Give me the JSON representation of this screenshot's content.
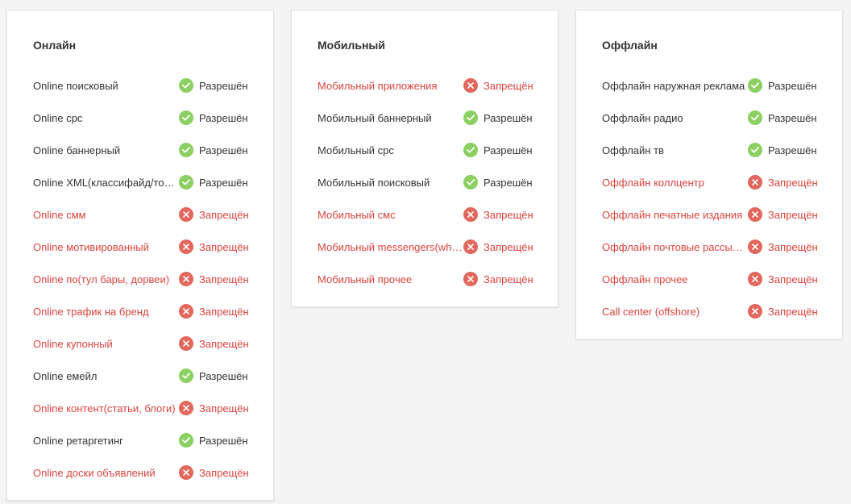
{
  "colors": {
    "allowed": "#8ccf62",
    "denied": "#e2675d",
    "denied_text": "#d9433d"
  },
  "status_labels": {
    "allowed": "Разрешён",
    "denied": "Запрещён"
  },
  "cards": [
    {
      "title": "Онлайн",
      "rows": [
        {
          "label": "Online поисковый",
          "status": "allowed"
        },
        {
          "label": "Online cpc",
          "status": "allowed"
        },
        {
          "label": "Online баннерный",
          "status": "allowed"
        },
        {
          "label": "Online XML(классифайд/товарный)",
          "status": "allowed"
        },
        {
          "label": "Online смм",
          "status": "denied"
        },
        {
          "label": "Online мотивированный",
          "status": "denied"
        },
        {
          "label": "Online по(тул бары, дорвеи)",
          "status": "denied"
        },
        {
          "label": "Online трафик на бренд",
          "status": "denied"
        },
        {
          "label": "Online купонный",
          "status": "denied"
        },
        {
          "label": "Online емейл",
          "status": "allowed"
        },
        {
          "label": "Online контент(статьи, блоги)",
          "status": "denied"
        },
        {
          "label": "Online ретаргетинг",
          "status": "allowed"
        },
        {
          "label": "Online доски объявлений",
          "status": "denied"
        }
      ]
    },
    {
      "title": "Мобильный",
      "rows": [
        {
          "label": "Мобильный приложения",
          "status": "denied"
        },
        {
          "label": "Мобильный баннерный",
          "status": "allowed"
        },
        {
          "label": "Мобильный cpc",
          "status": "allowed"
        },
        {
          "label": "Мобильный поисковый",
          "status": "allowed"
        },
        {
          "label": "Мобильный смс",
          "status": "denied"
        },
        {
          "label": "Мобильный messengers(whatsapp)",
          "status": "denied"
        },
        {
          "label": "Мобильный прочее",
          "status": "denied"
        }
      ]
    },
    {
      "title": "Оффлайн",
      "rows": [
        {
          "label": "Оффлайн наружная реклама",
          "status": "allowed"
        },
        {
          "label": "Оффлайн радио",
          "status": "allowed"
        },
        {
          "label": "Оффлайн тв",
          "status": "allowed"
        },
        {
          "label": "Оффлайн коллцентр",
          "status": "denied"
        },
        {
          "label": "Оффлайн печатные издания",
          "status": "denied"
        },
        {
          "label": "Оффлайн почтовые рассылки",
          "status": "denied"
        },
        {
          "label": "Оффлайн прочее",
          "status": "denied"
        },
        {
          "label": "Call center (offshore)",
          "status": "denied"
        }
      ]
    }
  ]
}
